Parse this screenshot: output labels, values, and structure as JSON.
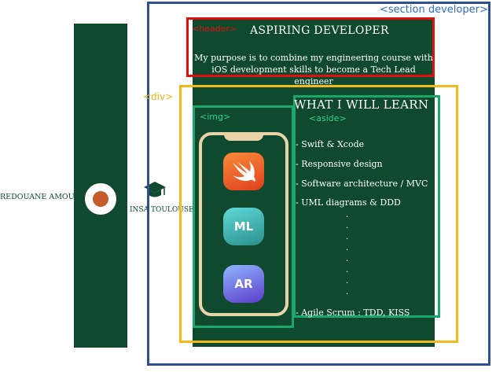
{
  "profile": {
    "name": "REDOUANE AMOUR",
    "school": "INSA TOULOUSE"
  },
  "annotations": {
    "section_tag": "<section developer>",
    "header_tag": "<header>",
    "div_tag": "<div>",
    "img_tag": "<img>",
    "aside_tag": "<aside>"
  },
  "header": {
    "title": "ASPIRING DEVELOPER",
    "description_line1": "My purpose is to combine my engineering course with",
    "description_line2": "iOS development skills to become a Tech Lead engineer"
  },
  "learn": {
    "title": "WHAT I WILL LEARN",
    "items": [
      "- Swift & Xcode",
      "- Responsive design",
      "- Software architecture / MVC",
      "- UML diagrams & DDD",
      "- Agile Scrum : TDD, KISS"
    ]
  },
  "phone_icons": {
    "swift": "swift-icon",
    "ml_label": "ML",
    "ar_label": "AR"
  },
  "colors": {
    "panel_green": "#0f4a2e",
    "section_border": "#2f4f93",
    "header_border": "#e01010",
    "div_border": "#f3b918",
    "img_aside_border": "#19a86a"
  }
}
